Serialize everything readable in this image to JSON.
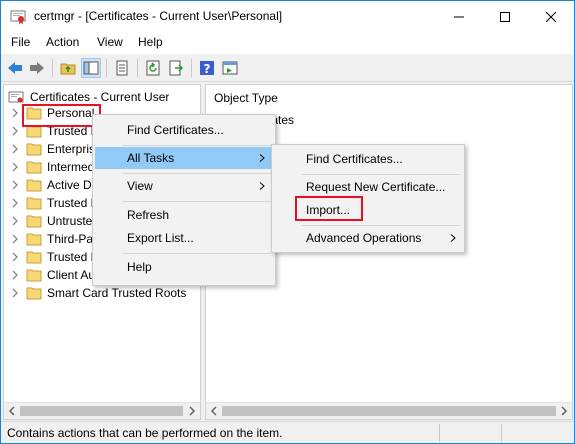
{
  "window": {
    "title": "certmgr - [Certificates - Current User\\Personal]",
    "icon": "certificate-app-icon"
  },
  "menubar": {
    "items": [
      "File",
      "Action",
      "View",
      "Help"
    ]
  },
  "toolbar": {
    "icons": [
      "back-arrow-icon",
      "forward-arrow-icon",
      "up-folder-icon",
      "show-hide-tree-icon",
      "export-list-icon",
      "refresh-icon",
      "export-icon",
      "help-icon",
      "properties-icon"
    ]
  },
  "tree": {
    "root": "Certificates - Current User",
    "items": [
      {
        "label": "Personal",
        "selected": true
      },
      {
        "label": "Trusted R"
      },
      {
        "label": "Enterpris"
      },
      {
        "label": "Intermed"
      },
      {
        "label": "Active Di"
      },
      {
        "label": "Trusted P"
      },
      {
        "label": "Untruste"
      },
      {
        "label": "Third-Pa"
      },
      {
        "label": "Trusted P"
      },
      {
        "label": "Client Au"
      },
      {
        "label": "Smart Card Trusted Roots"
      }
    ]
  },
  "right_pane": {
    "column_header": "Object Type",
    "item_label": "Certificates"
  },
  "context_menu": {
    "items": [
      "Find Certificates...",
      "All Tasks",
      "View",
      "Refresh",
      "Export List...",
      "Help"
    ]
  },
  "submenu": {
    "items": [
      "Find Certificates...",
      "Request New Certificate...",
      "Import...",
      "Advanced Operations"
    ]
  },
  "status": {
    "text": "Contains actions that can be performed on the item."
  },
  "colors": {
    "highlight_red": "#e81123",
    "menu_hover": "#91c9f7",
    "folder_yellow": "#f8d775",
    "window_border": "#1883d7"
  }
}
